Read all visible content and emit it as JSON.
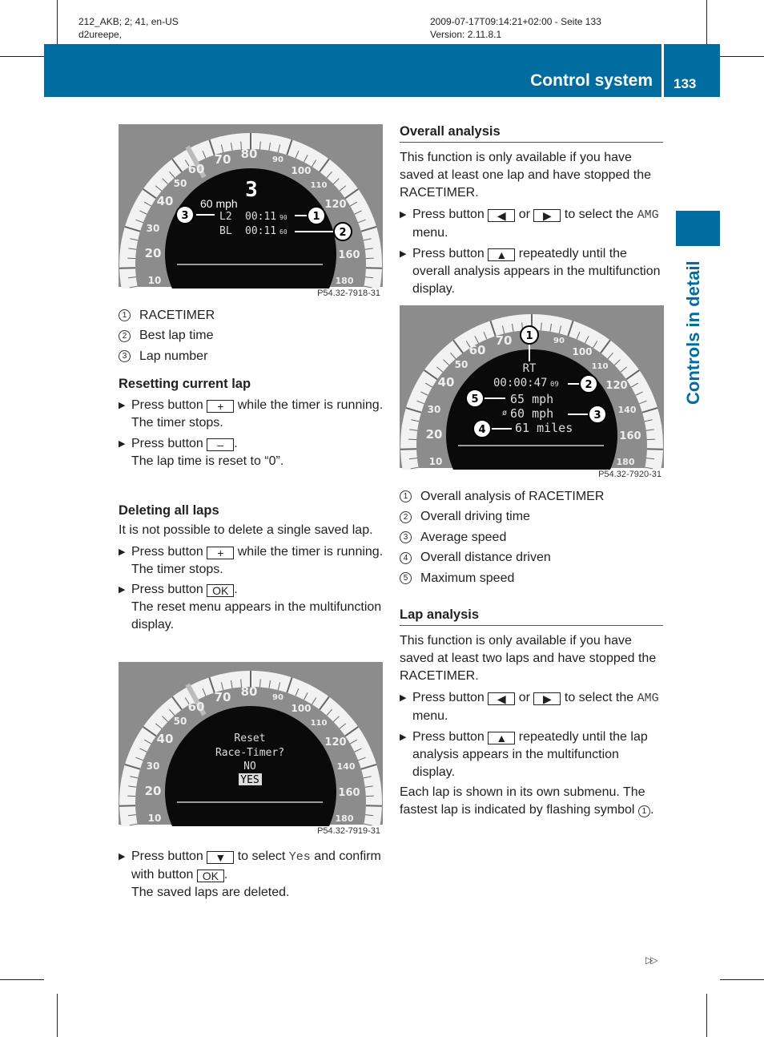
{
  "meta": {
    "left1": "212_AKB; 2; 41, en-US",
    "left2": "d2ureepe,",
    "right1": "2009-07-17T09:14:21+02:00 - Seite 133",
    "right2": "Version: 2.11.8.1"
  },
  "header": {
    "title": "Control system",
    "page": "133",
    "side_tab": "Controls in detail"
  },
  "colors": {
    "brand": "#006c9f"
  },
  "gauge_scale": [
    "10",
    "20",
    "30",
    "40",
    "50",
    "60",
    "70",
    "80",
    "90",
    "100",
    "110",
    "120",
    "140",
    "160",
    "180"
  ],
  "fig1": {
    "caption": "P54.32-7918-31",
    "lap": "3",
    "speed": "60 mph",
    "row1a": "L2",
    "row1b": "00:11",
    "row1c": "90",
    "row2a": "BL",
    "row2b": "00:11",
    "row2c": "60",
    "c1": "1",
    "c2": "2",
    "c3": "3"
  },
  "legend1": [
    {
      "n": "1",
      "t": "RACETIMER"
    },
    {
      "n": "2",
      "t": "Best lap time"
    },
    {
      "n": "3",
      "t": "Lap number"
    }
  ],
  "reset": {
    "heading": "Resetting current lap",
    "b1a": "Press button",
    "b1btn": "+",
    "b1b": "while the timer is running.",
    "b1c": "The timer stops.",
    "b2a": "Press button",
    "b2btn": "–",
    "b2b": ".",
    "b2c": "The lap time is reset to “0”."
  },
  "delete": {
    "heading": "Deleting all laps",
    "para": "It is not possible to delete a single saved lap.",
    "b1a": "Press button",
    "b1btn": "+",
    "b1b": "while the timer is running.",
    "b1c": "The timer stops.",
    "b2a": "Press button",
    "b2btn": "OK",
    "b2b": ".",
    "b2c": "The reset menu appears in the multifunction display.",
    "b3a": "Press button",
    "b3btn": "▼",
    "b3b": "to select",
    "b3yes": "Yes",
    "b3c": "and confirm with button",
    "b3btn2": "OK",
    "b3d": ".",
    "b3e": "The saved laps are deleted."
  },
  "fig3": {
    "caption": "P54.32-7919-31",
    "l1": "Reset",
    "l2": "Race-Timer?",
    "l3": "NO",
    "l4": "YES"
  },
  "overall": {
    "heading": "Overall analysis",
    "para": "This function is only available if you have saved at least one lap and have stopped the RACETIMER.",
    "b1a": "Press button",
    "b1btn": "◀",
    "b1or": "or",
    "b1btn2": "▶",
    "b1b": "to select the",
    "b1amg": "AMG",
    "b1c": "menu.",
    "b2a": "Press button",
    "b2btn": "▲",
    "b2b": "repeatedly until the overall analysis appears in the multifunction display."
  },
  "fig2": {
    "caption": "P54.32-7920-31",
    "rt": "RT",
    "time": "00:00:47",
    "time_small": "09",
    "max": "65 mph",
    "avg": "60 mph",
    "dist": "61 miles",
    "c1": "1",
    "c2": "2",
    "c3": "3",
    "c4": "4",
    "c5": "5"
  },
  "legend2": [
    {
      "n": "1",
      "t": "Overall analysis of RACETIMER"
    },
    {
      "n": "2",
      "t": "Overall driving time"
    },
    {
      "n": "3",
      "t": "Average speed"
    },
    {
      "n": "4",
      "t": "Overall distance driven"
    },
    {
      "n": "5",
      "t": "Maximum speed"
    }
  ],
  "lap": {
    "heading": "Lap analysis",
    "para": "This function is only available if you have saved at least two laps and have stopped the RACETIMER.",
    "b1a": "Press button",
    "b1btn": "◀",
    "b1or": "or",
    "b1btn2": "▶",
    "b1b": "to select the",
    "b1amg": "AMG",
    "b1c": "menu.",
    "b2a": "Press button",
    "b2btn": "▲",
    "b2b": "repeatedly until the lap analysis appears in the multifunction display.",
    "para2": "Each lap is shown in its own submenu. The fastest lap is indicated by flashing symbol",
    "para2n": "1",
    "para2end": "."
  },
  "footer": {
    "continue": "▷▷"
  }
}
